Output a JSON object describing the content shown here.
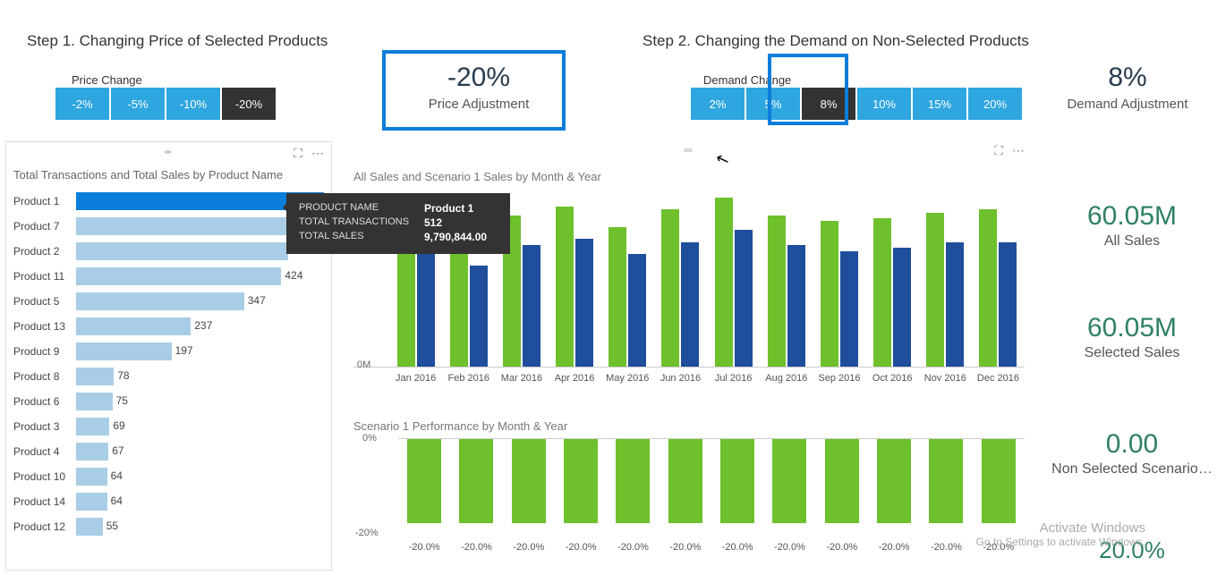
{
  "steps": {
    "step1": "Step 1. Changing Price of Selected Products",
    "step2": "Step 2. Changing the Demand on Non-Selected Products"
  },
  "price_change": {
    "label": "Price Change",
    "options": [
      "-2%",
      "-5%",
      "-10%",
      "-20%"
    ],
    "selected": "-20%"
  },
  "demand_change": {
    "label": "Demand Change",
    "options": [
      "2%",
      "5%",
      "8%",
      "10%",
      "15%",
      "20%"
    ],
    "selected": "8%"
  },
  "kpi": {
    "price_adj": {
      "value": "-20%",
      "caption": "Price Adjustment"
    },
    "demand_adj": {
      "value": "8%",
      "caption": "Demand Adjustment"
    },
    "all_sales": {
      "value": "60.05M",
      "caption": "All Sales"
    },
    "selected_sales": {
      "value": "60.05M",
      "caption": "Selected Sales"
    },
    "non_selected": {
      "value": "0.00",
      "caption": "Non Selected Scenario…"
    },
    "pct_line": {
      "value": "20.0%",
      "caption": ""
    }
  },
  "left_card": {
    "title": "Total Transactions and Total Sales by Product Name",
    "rows": [
      {
        "name": "Product 1",
        "val": 512,
        "selected": true
      },
      {
        "name": "Product 7",
        "val": 455,
        "selected": false
      },
      {
        "name": "Product 2",
        "val": 438,
        "selected": false
      },
      {
        "name": "Product 11",
        "val": 424,
        "selected": false
      },
      {
        "name": "Product 5",
        "val": 347,
        "selected": false
      },
      {
        "name": "Product 13",
        "val": 237,
        "selected": false
      },
      {
        "name": "Product 9",
        "val": 197,
        "selected": false
      },
      {
        "name": "Product 8",
        "val": 78,
        "selected": false
      },
      {
        "name": "Product 6",
        "val": 75,
        "selected": false
      },
      {
        "name": "Product 3",
        "val": 69,
        "selected": false
      },
      {
        "name": "Product 4",
        "val": 67,
        "selected": false
      },
      {
        "name": "Product 10",
        "val": 64,
        "selected": false
      },
      {
        "name": "Product 14",
        "val": 64,
        "selected": false
      },
      {
        "name": "Product 12",
        "val": 55,
        "selected": false
      }
    ]
  },
  "tooltip": {
    "product_name_k": "Product Name",
    "product_name_v": "Product 1",
    "tot_tx_k": "Total Transactions",
    "tot_tx_v": "512",
    "tot_sales_k": "Total Sales",
    "tot_sales_v": "9,790,844.00"
  },
  "sales_chart": {
    "title": "All Sales and Scenario 1 Sales by Month & Year",
    "yzero": "0M",
    "months": [
      "Jan 2016",
      "Feb 2016",
      "Mar 2016",
      "Apr 2016",
      "May 2016",
      "Jun 2016",
      "Jul 2016",
      "Aug 2016",
      "Sep 2016",
      "Oct 2016",
      "Nov 2016",
      "Dec 2016"
    ]
  },
  "perf_chart": {
    "title": "Scenario 1 Performance by Month & Year",
    "y0": "0%",
    "y1": "-20%",
    "labels": [
      "-20.0%",
      "-20.0%",
      "-20.0%",
      "-20.0%",
      "-20.0%",
      "-20.0%",
      "-20.0%",
      "-20.0%",
      "-20.0%",
      "-20.0%",
      "-20.0%",
      "-20.0%"
    ]
  },
  "watermark": {
    "title": "Activate Windows",
    "sub": "Go to Settings to activate Windows."
  },
  "chart_data": [
    {
      "type": "bar",
      "title": "Total Transactions and Total Sales by Product Name",
      "orientation": "horizontal",
      "categories": [
        "Product 1",
        "Product 7",
        "Product 2",
        "Product 11",
        "Product 5",
        "Product 13",
        "Product 9",
        "Product 8",
        "Product 6",
        "Product 3",
        "Product 4",
        "Product 10",
        "Product 14",
        "Product 12"
      ],
      "values": [
        512,
        455,
        438,
        424,
        347,
        237,
        197,
        78,
        75,
        69,
        67,
        64,
        64,
        55
      ],
      "selected_category": "Product 1",
      "xlabel": "",
      "ylabel": ""
    },
    {
      "type": "bar",
      "title": "All Sales and Scenario 1 Sales by Month & Year",
      "categories": [
        "Jan 2016",
        "Feb 2016",
        "Mar 2016",
        "Apr 2016",
        "May 2016",
        "Jun 2016",
        "Jul 2016",
        "Aug 2016",
        "Sep 2016",
        "Oct 2016",
        "Nov 2016",
        "Dec 2016"
      ],
      "series": [
        {
          "name": "All Sales",
          "color": "#6ec02c",
          "values": [
            5.0,
            4.3,
            5.1,
            5.4,
            4.7,
            5.3,
            5.7,
            5.1,
            4.9,
            5.0,
            5.2,
            5.3
          ]
        },
        {
          "name": "Scenario 1 Sales",
          "color": "#1f4e9c",
          "values": [
            4.0,
            3.4,
            4.1,
            4.3,
            3.8,
            4.2,
            4.6,
            4.1,
            3.9,
            4.0,
            4.2,
            4.2
          ]
        }
      ],
      "ylabel": "M",
      "ylim": [
        0,
        6
      ]
    },
    {
      "type": "bar",
      "title": "Scenario 1 Performance by Month & Year",
      "categories": [
        "Jan 2016",
        "Feb 2016",
        "Mar 2016",
        "Apr 2016",
        "May 2016",
        "Jun 2016",
        "Jul 2016",
        "Aug 2016",
        "Sep 2016",
        "Oct 2016",
        "Nov 2016",
        "Dec 2016"
      ],
      "values": [
        -20,
        -20,
        -20,
        -20,
        -20,
        -20,
        -20,
        -20,
        -20,
        -20,
        -20,
        -20
      ],
      "ylabel": "%",
      "ylim": [
        -25,
        0
      ]
    }
  ]
}
